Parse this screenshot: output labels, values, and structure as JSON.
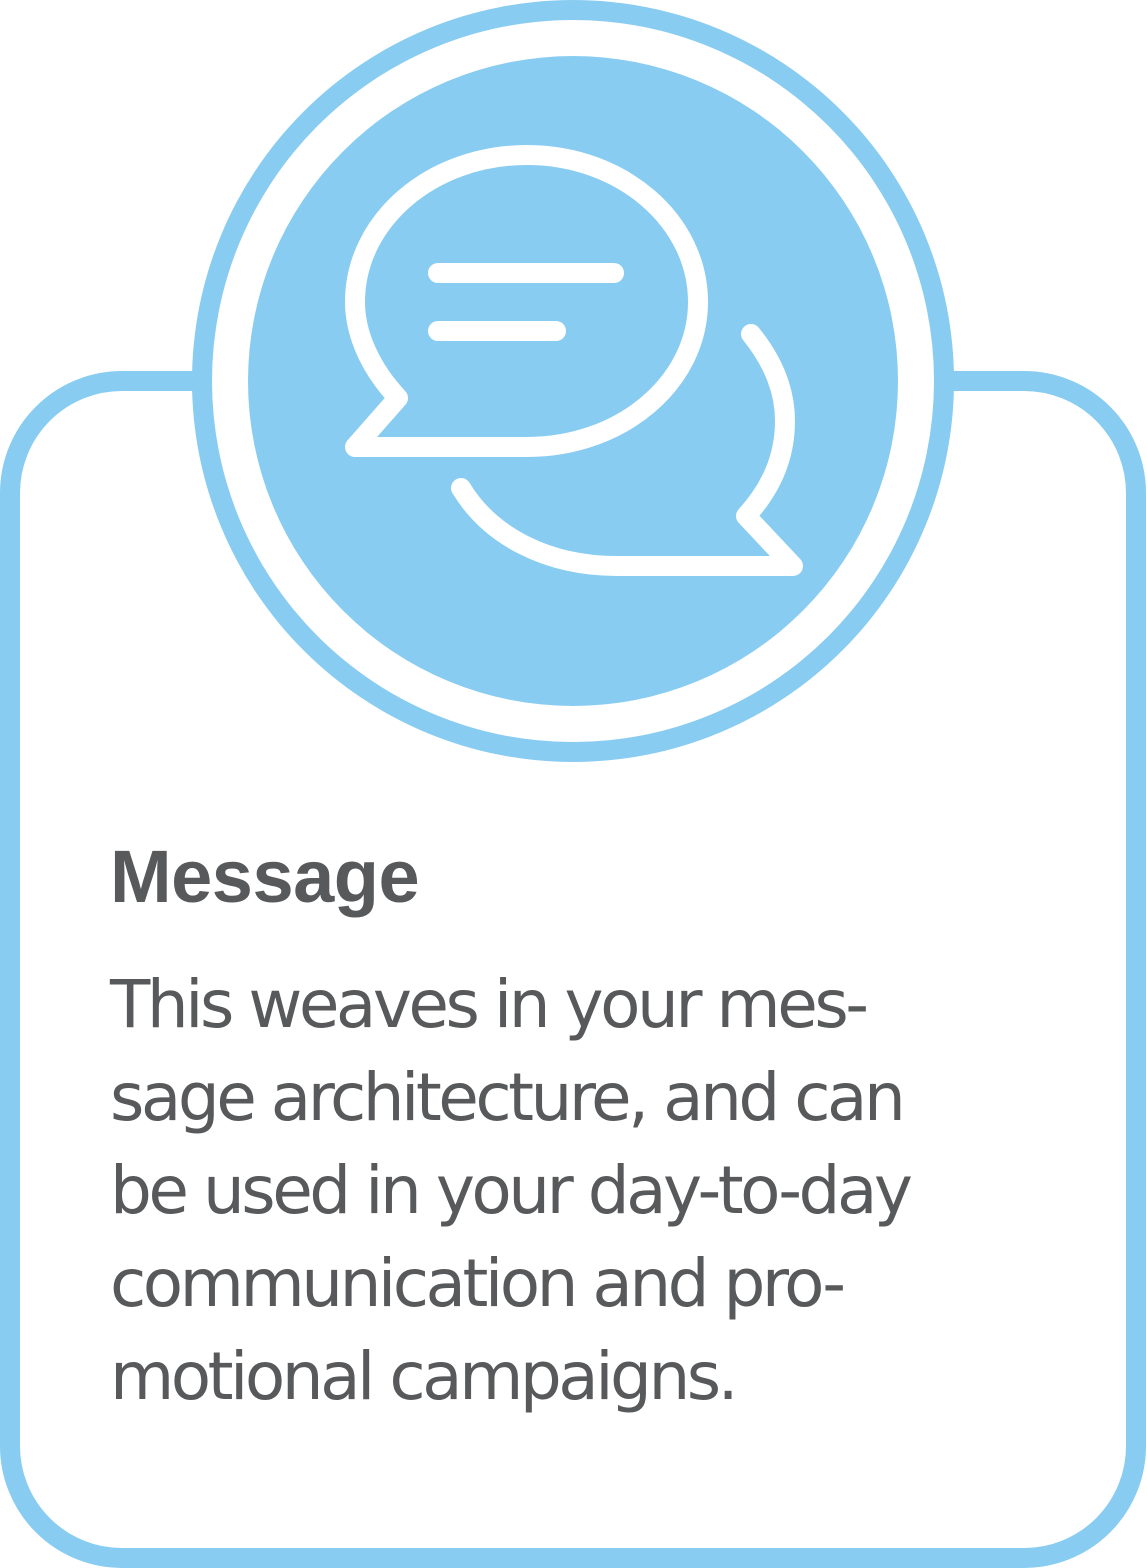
{
  "colors": {
    "accent": "#88ccf1",
    "outline": "#88ccf1",
    "icon_stroke": "#ffffff",
    "text": "#58595b",
    "background": "#ffffff"
  },
  "icon": "chat-bubbles-icon",
  "card": {
    "title": "Message",
    "body_lines": [
      "This weaves in your mes-",
      "sage architecture, and can",
      "be used in your day-to-day",
      "communication and pro-",
      "motional campaigns."
    ]
  }
}
